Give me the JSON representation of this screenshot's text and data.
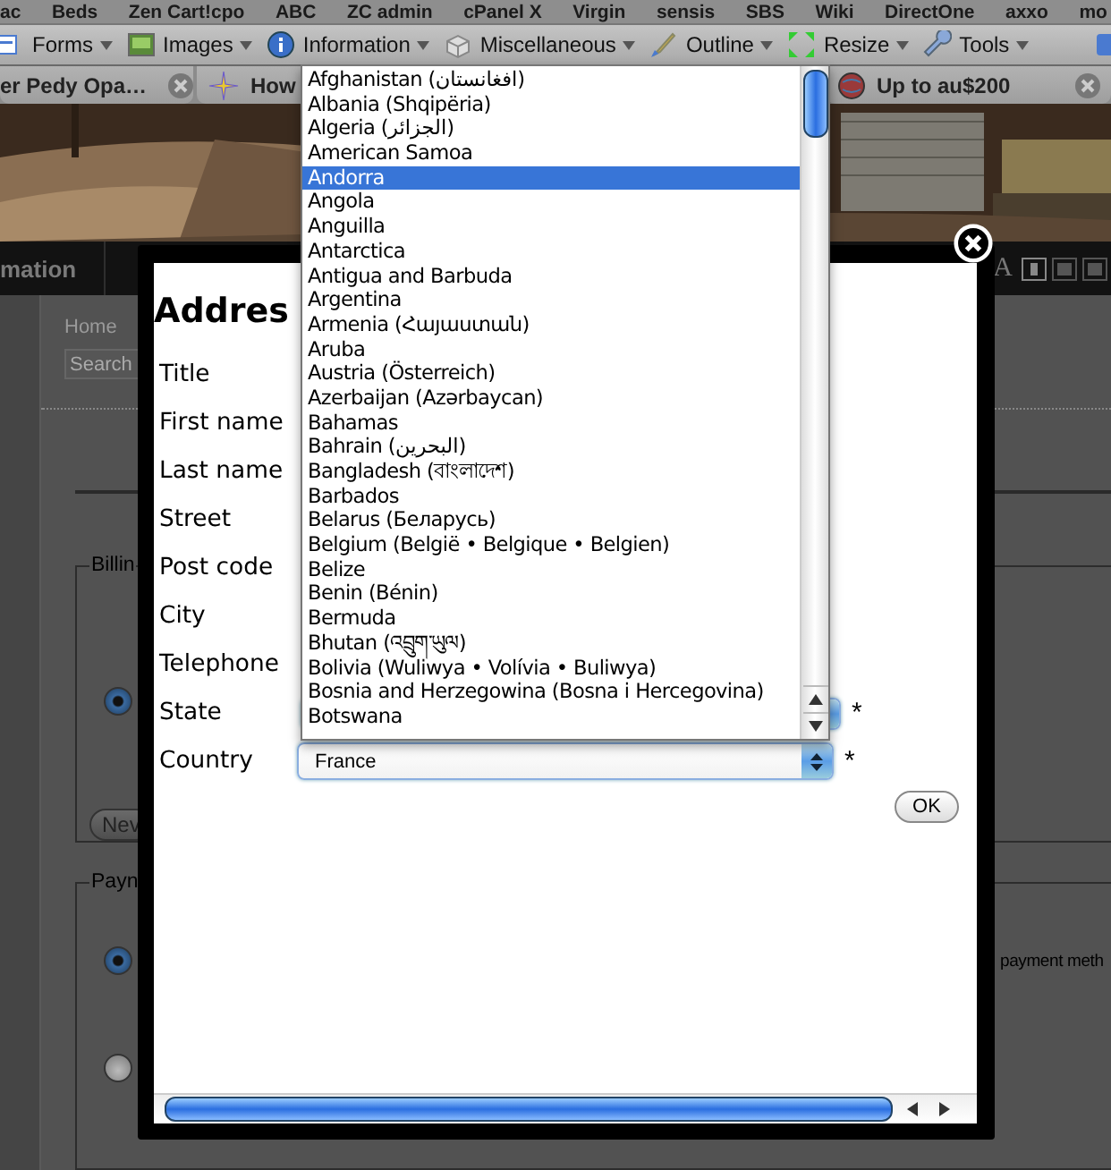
{
  "bookmarks_bar": [
    "ac",
    "Beds",
    "Zen Cart!cpo",
    "ABC",
    "ZC admin",
    "cPanel X",
    "Virgin",
    "sensis",
    "SBS",
    "Wiki",
    "DirectOne",
    "axxo",
    "mo"
  ],
  "developer_toolbar": [
    {
      "label": "Forms"
    },
    {
      "label": "Images"
    },
    {
      "label": "Information"
    },
    {
      "label": "Miscellaneous"
    },
    {
      "label": "Outline"
    },
    {
      "label": "Resize"
    },
    {
      "label": "Tools"
    }
  ],
  "tabs": [
    {
      "label": "er Pedy Opa…",
      "selected": false
    },
    {
      "label": "How",
      "selected": false
    },
    {
      "label": "Up to au$200",
      "selected": false
    }
  ],
  "site_nav": {
    "item": "mation",
    "text_size_label": "A"
  },
  "page": {
    "breadcrumb": "Home",
    "search_placeholder": "Search",
    "billing": {
      "legend": "Billin",
      "address_selected": true,
      "new_button": "Nev"
    },
    "payment": {
      "legend": "Payn",
      "methods": [
        {
          "selected": true,
          "note": "payment meth"
        },
        {
          "selected": false
        }
      ]
    }
  },
  "dialog": {
    "heading": "Addres",
    "fields": [
      {
        "label": "Title",
        "kind": "text"
      },
      {
        "label": "First name",
        "kind": "text"
      },
      {
        "label": "Last name",
        "kind": "text"
      },
      {
        "label": "Street",
        "kind": "text"
      },
      {
        "label": "Post code",
        "kind": "text"
      },
      {
        "label": "City",
        "kind": "text"
      },
      {
        "label": "Telephone",
        "kind": "text"
      },
      {
        "label": "State",
        "kind": "select",
        "required_mark": "*"
      },
      {
        "label": "Country",
        "kind": "select",
        "value": "France",
        "required_mark": "*"
      }
    ],
    "ok_button": "OK"
  },
  "country_list": {
    "options": [
      {
        "label": "Afghanistan (افغانستان)",
        "selected": false
      },
      {
        "label": "Albania (Shqipëria)",
        "selected": false
      },
      {
        "label": "Algeria (الجزائر)",
        "selected": false
      },
      {
        "label": "American Samoa",
        "selected": false
      },
      {
        "label": "Andorra",
        "selected": true
      },
      {
        "label": "Angola",
        "selected": false
      },
      {
        "label": "Anguilla",
        "selected": false
      },
      {
        "label": "Antarctica",
        "selected": false
      },
      {
        "label": "Antigua and Barbuda",
        "selected": false
      },
      {
        "label": "Argentina",
        "selected": false
      },
      {
        "label": "Armenia (Հայաստան)",
        "selected": false
      },
      {
        "label": "Aruba",
        "selected": false
      },
      {
        "label": "Austria (Österreich)",
        "selected": false
      },
      {
        "label": "Azerbaijan (Azərbaycan)",
        "selected": false
      },
      {
        "label": "Bahamas",
        "selected": false
      },
      {
        "label": "Bahrain (البحرين)",
        "selected": false
      },
      {
        "label": "Bangladesh (বাংলাদেশ)",
        "selected": false
      },
      {
        "label": "Barbados",
        "selected": false
      },
      {
        "label": "Belarus (Беларусь)",
        "selected": false
      },
      {
        "label": "Belgium (België • Belgique • Belgien)",
        "selected": false
      },
      {
        "label": "Belize",
        "selected": false
      },
      {
        "label": "Benin (Bénin)",
        "selected": false
      },
      {
        "label": "Bermuda",
        "selected": false
      },
      {
        "label": "Bhutan (འབྲུག་ཡུལ)",
        "selected": false
      },
      {
        "label": "Bolivia (Wuliwya • Volívia • Buliwya)",
        "selected": false
      },
      {
        "label": "Bosnia and Herzegowina (Bosna i Hercegovina)",
        "selected": false
      },
      {
        "label": "Botswana",
        "selected": false
      }
    ]
  }
}
